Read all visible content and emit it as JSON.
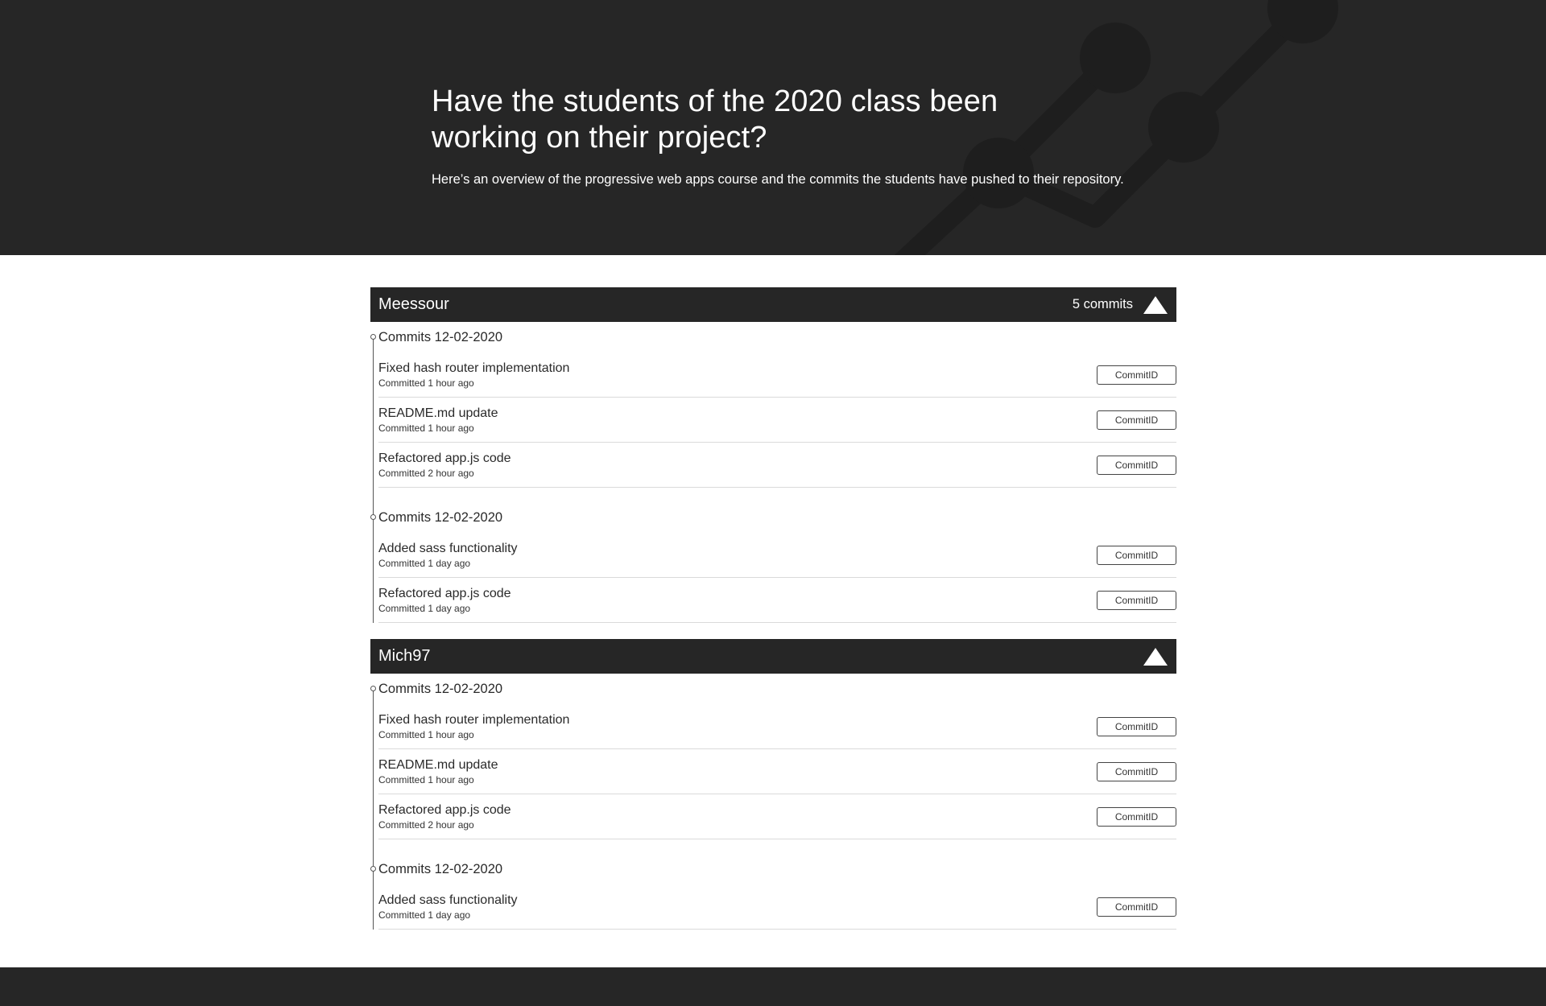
{
  "hero": {
    "title_line1": "Have the students of the 2020 class been",
    "title_line2": "working on their project?",
    "subtitle": "Here’s an overview of the progressive web apps course and the commits the students have pushed to their repository."
  },
  "colors": {
    "dark": "#262626",
    "deco": "#1e1e1e",
    "divider": "#dadada"
  },
  "students": [
    {
      "name": "Meessour",
      "commit_count": "5 commits",
      "toggle_icon": "triangle-up-icon",
      "days": [
        {
          "label": "Commits 12-02-2020",
          "commits": [
            {
              "message": "Fixed hash router implementation",
              "time": "Committed 1 hour ago",
              "button": "CommitID"
            },
            {
              "message": "README.md update",
              "time": "Committed 1 hour ago",
              "button": "CommitID"
            },
            {
              "message": "Refactored app.js code",
              "time": "Committed 2 hour ago",
              "button": "CommitID"
            }
          ]
        },
        {
          "label": "Commits 12-02-2020",
          "commits": [
            {
              "message": "Added sass functionality",
              "time": "Committed 1 day ago",
              "button": "CommitID"
            },
            {
              "message": "Refactored app.js code",
              "time": "Committed 1 day ago",
              "button": "CommitID"
            }
          ]
        }
      ]
    },
    {
      "name": "Mich97",
      "commit_count": "",
      "toggle_icon": "triangle-up-icon",
      "days": [
        {
          "label": "Commits 12-02-2020",
          "commits": [
            {
              "message": "Fixed hash router implementation",
              "time": "Committed 1 hour ago",
              "button": "CommitID"
            },
            {
              "message": "README.md update",
              "time": "Committed 1 hour ago",
              "button": "CommitID"
            },
            {
              "message": "Refactored app.js code",
              "time": "Committed 2 hour ago",
              "button": "CommitID"
            }
          ]
        },
        {
          "label": "Commits 12-02-2020",
          "commits": [
            {
              "message": "Added sass functionality",
              "time": "Committed 1 day ago",
              "button": "CommitID"
            }
          ]
        }
      ]
    }
  ]
}
